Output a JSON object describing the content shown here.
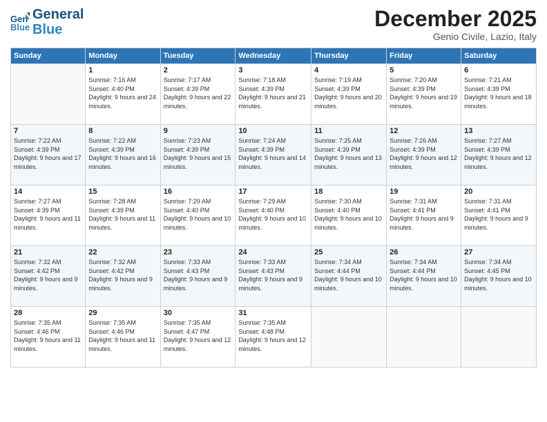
{
  "logo": {
    "line1": "General",
    "line2": "Blue"
  },
  "header": {
    "month": "December 2025",
    "location": "Genio Civile, Lazio, Italy"
  },
  "days_of_week": [
    "Sunday",
    "Monday",
    "Tuesday",
    "Wednesday",
    "Thursday",
    "Friday",
    "Saturday"
  ],
  "weeks": [
    [
      {
        "day": "",
        "sunrise": "",
        "sunset": "",
        "daylight": ""
      },
      {
        "day": "1",
        "sunrise": "Sunrise: 7:16 AM",
        "sunset": "Sunset: 4:40 PM",
        "daylight": "Daylight: 9 hours and 24 minutes."
      },
      {
        "day": "2",
        "sunrise": "Sunrise: 7:17 AM",
        "sunset": "Sunset: 4:39 PM",
        "daylight": "Daylight: 9 hours and 22 minutes."
      },
      {
        "day": "3",
        "sunrise": "Sunrise: 7:18 AM",
        "sunset": "Sunset: 4:39 PM",
        "daylight": "Daylight: 9 hours and 21 minutes."
      },
      {
        "day": "4",
        "sunrise": "Sunrise: 7:19 AM",
        "sunset": "Sunset: 4:39 PM",
        "daylight": "Daylight: 9 hours and 20 minutes."
      },
      {
        "day": "5",
        "sunrise": "Sunrise: 7:20 AM",
        "sunset": "Sunset: 4:39 PM",
        "daylight": "Daylight: 9 hours and 19 minutes."
      },
      {
        "day": "6",
        "sunrise": "Sunrise: 7:21 AM",
        "sunset": "Sunset: 4:39 PM",
        "daylight": "Daylight: 9 hours and 18 minutes."
      }
    ],
    [
      {
        "day": "7",
        "sunrise": "Sunrise: 7:22 AM",
        "sunset": "Sunset: 4:39 PM",
        "daylight": "Daylight: 9 hours and 17 minutes."
      },
      {
        "day": "8",
        "sunrise": "Sunrise: 7:22 AM",
        "sunset": "Sunset: 4:39 PM",
        "daylight": "Daylight: 9 hours and 16 minutes."
      },
      {
        "day": "9",
        "sunrise": "Sunrise: 7:23 AM",
        "sunset": "Sunset: 4:39 PM",
        "daylight": "Daylight: 9 hours and 15 minutes."
      },
      {
        "day": "10",
        "sunrise": "Sunrise: 7:24 AM",
        "sunset": "Sunset: 4:39 PM",
        "daylight": "Daylight: 9 hours and 14 minutes."
      },
      {
        "day": "11",
        "sunrise": "Sunrise: 7:25 AM",
        "sunset": "Sunset: 4:39 PM",
        "daylight": "Daylight: 9 hours and 13 minutes."
      },
      {
        "day": "12",
        "sunrise": "Sunrise: 7:26 AM",
        "sunset": "Sunset: 4:39 PM",
        "daylight": "Daylight: 9 hours and 12 minutes."
      },
      {
        "day": "13",
        "sunrise": "Sunrise: 7:27 AM",
        "sunset": "Sunset: 4:39 PM",
        "daylight": "Daylight: 9 hours and 12 minutes."
      }
    ],
    [
      {
        "day": "14",
        "sunrise": "Sunrise: 7:27 AM",
        "sunset": "Sunset: 4:39 PM",
        "daylight": "Daylight: 9 hours and 11 minutes."
      },
      {
        "day": "15",
        "sunrise": "Sunrise: 7:28 AM",
        "sunset": "Sunset: 4:39 PM",
        "daylight": "Daylight: 9 hours and 11 minutes."
      },
      {
        "day": "16",
        "sunrise": "Sunrise: 7:29 AM",
        "sunset": "Sunset: 4:40 PM",
        "daylight": "Daylight: 9 hours and 10 minutes."
      },
      {
        "day": "17",
        "sunrise": "Sunrise: 7:29 AM",
        "sunset": "Sunset: 4:40 PM",
        "daylight": "Daylight: 9 hours and 10 minutes."
      },
      {
        "day": "18",
        "sunrise": "Sunrise: 7:30 AM",
        "sunset": "Sunset: 4:40 PM",
        "daylight": "Daylight: 9 hours and 10 minutes."
      },
      {
        "day": "19",
        "sunrise": "Sunrise: 7:31 AM",
        "sunset": "Sunset: 4:41 PM",
        "daylight": "Daylight: 9 hours and 9 minutes."
      },
      {
        "day": "20",
        "sunrise": "Sunrise: 7:31 AM",
        "sunset": "Sunset: 4:41 PM",
        "daylight": "Daylight: 9 hours and 9 minutes."
      }
    ],
    [
      {
        "day": "21",
        "sunrise": "Sunrise: 7:32 AM",
        "sunset": "Sunset: 4:42 PM",
        "daylight": "Daylight: 9 hours and 9 minutes."
      },
      {
        "day": "22",
        "sunrise": "Sunrise: 7:32 AM",
        "sunset": "Sunset: 4:42 PM",
        "daylight": "Daylight: 9 hours and 9 minutes."
      },
      {
        "day": "23",
        "sunrise": "Sunrise: 7:33 AM",
        "sunset": "Sunset: 4:43 PM",
        "daylight": "Daylight: 9 hours and 9 minutes."
      },
      {
        "day": "24",
        "sunrise": "Sunrise: 7:33 AM",
        "sunset": "Sunset: 4:43 PM",
        "daylight": "Daylight: 9 hours and 9 minutes."
      },
      {
        "day": "25",
        "sunrise": "Sunrise: 7:34 AM",
        "sunset": "Sunset: 4:44 PM",
        "daylight": "Daylight: 9 hours and 10 minutes."
      },
      {
        "day": "26",
        "sunrise": "Sunrise: 7:34 AM",
        "sunset": "Sunset: 4:44 PM",
        "daylight": "Daylight: 9 hours and 10 minutes."
      },
      {
        "day": "27",
        "sunrise": "Sunrise: 7:34 AM",
        "sunset": "Sunset: 4:45 PM",
        "daylight": "Daylight: 9 hours and 10 minutes."
      }
    ],
    [
      {
        "day": "28",
        "sunrise": "Sunrise: 7:35 AM",
        "sunset": "Sunset: 4:46 PM",
        "daylight": "Daylight: 9 hours and 11 minutes."
      },
      {
        "day": "29",
        "sunrise": "Sunrise: 7:35 AM",
        "sunset": "Sunset: 4:46 PM",
        "daylight": "Daylight: 9 hours and 11 minutes."
      },
      {
        "day": "30",
        "sunrise": "Sunrise: 7:35 AM",
        "sunset": "Sunset: 4:47 PM",
        "daylight": "Daylight: 9 hours and 12 minutes."
      },
      {
        "day": "31",
        "sunrise": "Sunrise: 7:35 AM",
        "sunset": "Sunset: 4:48 PM",
        "daylight": "Daylight: 9 hours and 12 minutes."
      },
      {
        "day": "",
        "sunrise": "",
        "sunset": "",
        "daylight": ""
      },
      {
        "day": "",
        "sunrise": "",
        "sunset": "",
        "daylight": ""
      },
      {
        "day": "",
        "sunrise": "",
        "sunset": "",
        "daylight": ""
      }
    ]
  ]
}
